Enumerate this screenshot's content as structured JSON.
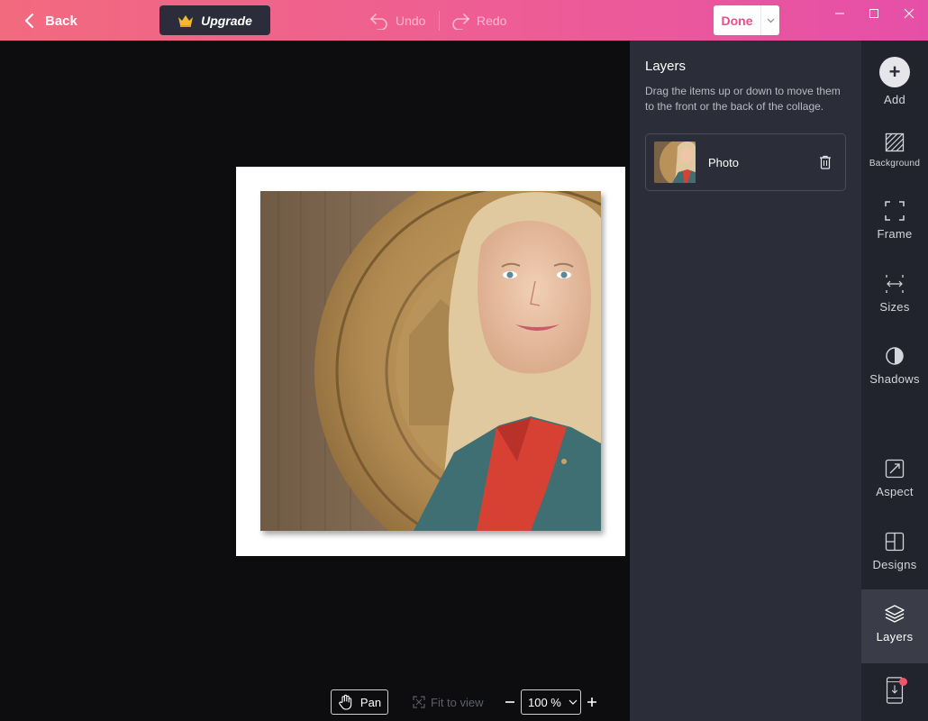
{
  "topbar": {
    "back_label": "Back",
    "upgrade_label": "Upgrade",
    "undo_label": "Undo",
    "redo_label": "Redo",
    "done_label": "Done",
    "gradient_start": "#f26a7e",
    "gradient_end": "#e64fa8"
  },
  "layers_panel": {
    "title": "Layers",
    "description": "Drag the items up or down to move them to the front or the back of the collage.",
    "items": [
      {
        "label": "Photo"
      }
    ]
  },
  "canvas_tools": {
    "pan_label": "Pan",
    "fit_label": "Fit to view",
    "zoom_value": "100 %"
  },
  "rail": {
    "items": [
      {
        "label": "Add",
        "icon": "plus-icon"
      },
      {
        "label": "Background",
        "icon": "hatch-icon"
      },
      {
        "label": "Frame",
        "icon": "frame-corners-icon"
      },
      {
        "label": "Sizes",
        "icon": "sizes-icon"
      },
      {
        "label": "Shadows",
        "icon": "half-circle-icon"
      },
      {
        "label": "Aspect",
        "icon": "aspect-icon"
      },
      {
        "label": "Designs",
        "icon": "grid-icon"
      },
      {
        "label": "Layers",
        "icon": "layers-icon",
        "active": true
      },
      {
        "label": "",
        "icon": "phone-download-icon"
      }
    ]
  }
}
